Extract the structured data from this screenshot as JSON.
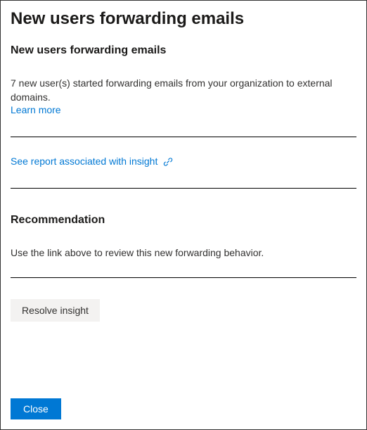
{
  "page": {
    "title": "New users forwarding emails"
  },
  "insight": {
    "heading": "New users forwarding emails",
    "summary": "7 new user(s) started forwarding emails from your organization to external domains.",
    "learn_more_label": "Learn more",
    "report_link_label": "See report associated with insight"
  },
  "recommendation": {
    "heading": "Recommendation",
    "body": "Use the link above to review this new forwarding behavior."
  },
  "actions": {
    "resolve_label": "Resolve insight",
    "close_label": "Close"
  }
}
